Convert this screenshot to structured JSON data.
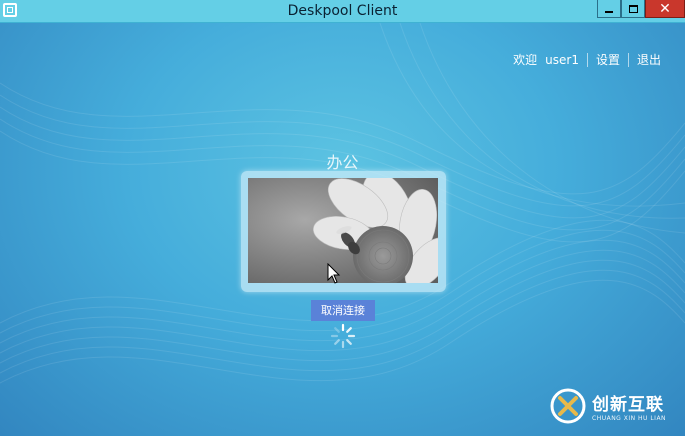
{
  "window": {
    "title": "Deskpool Client",
    "controls": {
      "minimize": "minimize",
      "maximize": "maximize",
      "close": "close"
    }
  },
  "nav": {
    "welcome": "欢迎",
    "username": "user1",
    "settings": "设置",
    "logout": "退出"
  },
  "desktop": {
    "name": "办公",
    "cancel_label": "取消连接"
  },
  "watermark": {
    "brand_cn": "创新互联",
    "brand_en": "CHUANG XIN HU LIAN"
  },
  "colors": {
    "titlebar": "#64cfe6",
    "background": "#45addb",
    "cancel_button": "#5a82d8",
    "close_button": "#c9372c"
  }
}
